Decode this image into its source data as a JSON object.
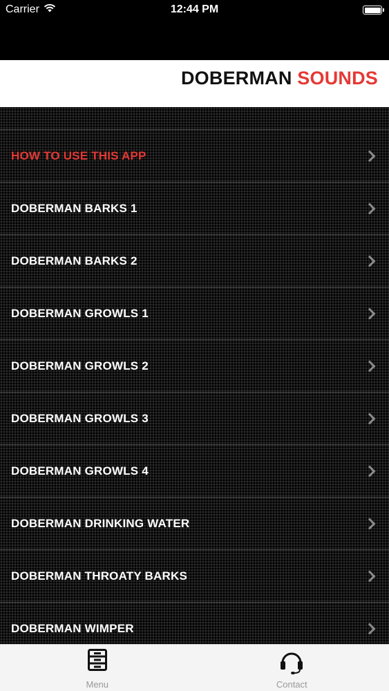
{
  "status_bar": {
    "carrier": "Carrier",
    "time": "12:44 PM",
    "battery_level": 1.0
  },
  "header": {
    "title_part1": "DOBERMAN",
    "title_part2": "SOUNDS",
    "accent_color": "#e53935"
  },
  "menu": {
    "items": [
      {
        "label": "HOW TO USE THIS APP",
        "highlight": true
      },
      {
        "label": "DOBERMAN BARKS 1"
      },
      {
        "label": "DOBERMAN BARKS 2"
      },
      {
        "label": "DOBERMAN GROWLS 1"
      },
      {
        "label": "DOBERMAN GROWLS 2"
      },
      {
        "label": "DOBERMAN GROWLS 3"
      },
      {
        "label": "DOBERMAN GROWLS 4"
      },
      {
        "label": "DOBERMAN DRINKING WATER"
      },
      {
        "label": "DOBERMAN THROATY BARKS"
      },
      {
        "label": "DOBERMAN WIMPER"
      }
    ]
  },
  "tab_bar": {
    "tabs": [
      {
        "label": "Menu",
        "icon": "menu-cabinet-icon"
      },
      {
        "label": "Contact",
        "icon": "headset-icon"
      }
    ]
  }
}
